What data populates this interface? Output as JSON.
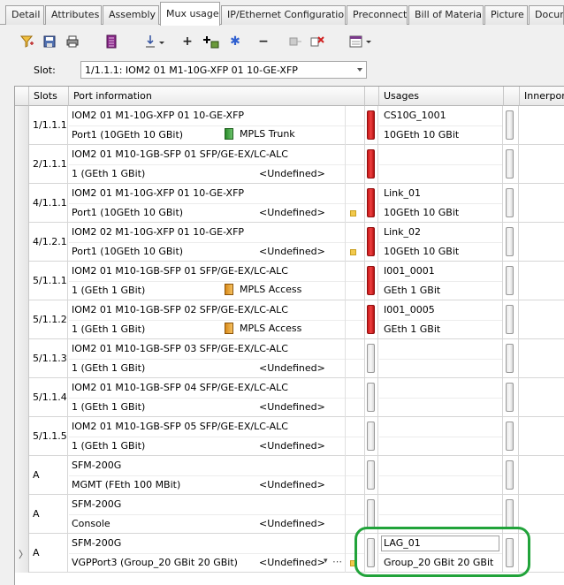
{
  "tabs": [
    {
      "label": "Detail"
    },
    {
      "label": "Attributes"
    },
    {
      "label": "Assembly"
    },
    {
      "label": "Mux usage"
    },
    {
      "label": "IP/Ethernet Configuration"
    },
    {
      "label": "Preconnect"
    },
    {
      "label": "Bill of Material"
    },
    {
      "label": "Picture"
    },
    {
      "label": "Docum"
    }
  ],
  "active_tab": "Mux usage",
  "toolbar": {
    "icons": [
      "filter-icon",
      "save-icon",
      "print-icon",
      "list-icon",
      "sort-icon",
      "add-icon",
      "add-to-group-icon",
      "snowflake-icon",
      "remove-icon",
      "disconnect-icon",
      "delete-icon",
      "report-icon"
    ]
  },
  "slot": {
    "label": "Slot:",
    "value": "1/1.1.1: IOM2 01 M1-10G-XFP 01 10-GE-XFP"
  },
  "grid": {
    "headers": {
      "slots": "Slots",
      "port_information": "Port information",
      "usages": "Usages",
      "innerport": "Innerport"
    },
    "rows": [
      {
        "slot": "1/1.1.1",
        "card": "IOM2 01 M1-10G-XFP 01 10-GE-XFP",
        "port": "Port1 (10GEth 10 GBit)",
        "service": "MPLS Trunk",
        "service_icon": "mpls-trunk-icon",
        "undefined": "",
        "status": "red",
        "usage_name": "CS10G_1001",
        "usage_rate": "10GEth 10 GBit",
        "indicator": false
      },
      {
        "slot": "2/1.1.1",
        "card": "IOM2 01 M10-1GB-SFP 01 SFP/GE-EX/LC-ALC",
        "port": "1 (GEth 1 GBit)",
        "service": "",
        "undefined": "<Undefined>",
        "status": "red",
        "usage_name": "",
        "usage_rate": "",
        "indicator": false
      },
      {
        "slot": "4/1.1.1",
        "card": "IOM2 01 M1-10G-XFP 01 10-GE-XFP",
        "port": "Port1 (10GEth 10 GBit)",
        "service": "",
        "undefined": "<Undefined>",
        "status": "red",
        "usage_name": "Link_01",
        "usage_rate": "10GEth 10 GBit",
        "indicator": true
      },
      {
        "slot": "4/1.2.1",
        "card": "IOM2 02 M1-10G-XFP 01 10-GE-XFP",
        "port": "Port1 (10GEth 10 GBit)",
        "service": "",
        "undefined": "<Undefined>",
        "status": "red",
        "usage_name": "Link_02",
        "usage_rate": "10GEth 10 GBit",
        "indicator": true
      },
      {
        "slot": "5/1.1.1",
        "card": "IOM2 01 M10-1GB-SFP 01 SFP/GE-EX/LC-ALC",
        "port": "1 (GEth 1 GBit)",
        "service": "MPLS Access",
        "service_icon": "mpls-access-icon",
        "undefined": "",
        "status": "red",
        "usage_name": "I001_0001",
        "usage_rate": "GEth 1 GBit",
        "indicator": false
      },
      {
        "slot": "5/1.1.2",
        "card": "IOM2 01 M10-1GB-SFP 02 SFP/GE-EX/LC-ALC",
        "port": "1 (GEth 1 GBit)",
        "service": "MPLS Access",
        "service_icon": "mpls-access-icon",
        "undefined": "",
        "status": "red",
        "usage_name": "I001_0005",
        "usage_rate": "GEth 1 GBit",
        "indicator": false
      },
      {
        "slot": "5/1.1.3",
        "card": "IOM2 01 M10-1GB-SFP 03 SFP/GE-EX/LC-ALC",
        "port": "1 (GEth 1 GBit)",
        "service": "",
        "undefined": "<Undefined>",
        "status": "grey",
        "usage_name": "",
        "usage_rate": "",
        "indicator": false
      },
      {
        "slot": "5/1.1.4",
        "card": "IOM2 01 M10-1GB-SFP 04 SFP/GE-EX/LC-ALC",
        "port": "1 (GEth 1 GBit)",
        "service": "",
        "undefined": "<Undefined>",
        "status": "grey",
        "usage_name": "",
        "usage_rate": "",
        "indicator": false
      },
      {
        "slot": "5/1.1.5",
        "card": "IOM2 01 M10-1GB-SFP 05 SFP/GE-EX/LC-ALC",
        "port": "1 (GEth 1 GBit)",
        "service": "",
        "undefined": "<Undefined>",
        "status": "grey",
        "usage_name": "",
        "usage_rate": "",
        "indicator": false
      },
      {
        "slot": "A",
        "card": "SFM-200G",
        "port": "MGMT (FEth 100 MBit)",
        "service": "",
        "undefined": "<Undefined>",
        "status": "grey",
        "usage_name": "",
        "usage_rate": "",
        "indicator": false
      },
      {
        "slot": "A",
        "card": "SFM-200G",
        "port": "Console",
        "service": "",
        "undefined": "<Undefined>",
        "status": "grey",
        "usage_name": "",
        "usage_rate": "",
        "indicator": false
      },
      {
        "slot": "A",
        "card": "SFM-200G",
        "port": "VGPPort3 (Group_20 GBit 20 GBit)",
        "service": "",
        "undefined": "<Undefined>",
        "status": "grey",
        "usage_name": "LAG_01",
        "usage_rate": "Group_20 GBit 20 GBit",
        "indicator": true,
        "selected": true
      }
    ]
  },
  "colors": {
    "status_red": "#e02020",
    "highlight_green": "#21a33a",
    "indicator_yellow": "#f2c94c"
  }
}
